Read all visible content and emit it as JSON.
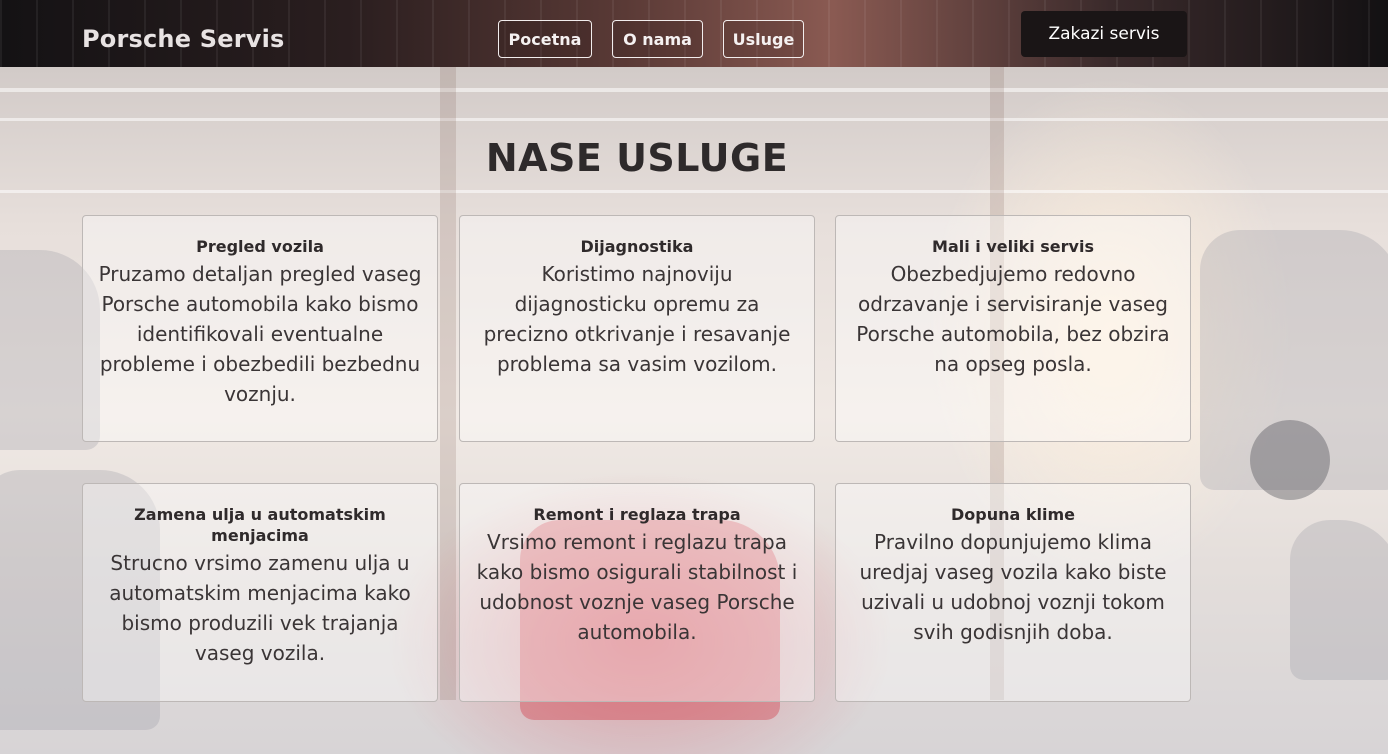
{
  "nav": {
    "logo": "Porsche Servis",
    "links": [
      "Pocetna",
      "O nama",
      "Usluge"
    ],
    "cta_label": "Zakazi servis"
  },
  "main": {
    "title": "NASE USLUGE",
    "services": [
      {
        "title": "Pregled vozila",
        "text": "Pruzamo detaljan pregled vaseg Porsche automobila kako bismo identifikovali eventualne probleme i obezbedili bezbednu voznju."
      },
      {
        "title": "Dijagnostika",
        "text": "Koristimo najnoviju dijagnosticku opremu za precizno otkrivanje i resavanje problema sa vasim vozilom."
      },
      {
        "title": "Mali i veliki servis",
        "text": "Obezbedjujemo redovno odrzavanje i servisiranje vaseg Porsche automobila, bez obzira na opseg posla."
      },
      {
        "title": "Zamena ulja u automatskim menjacima",
        "text": "Strucno vrsimo zamenu ulja u automatskim menjacima kako bismo produzili vek trajanja vaseg vozila."
      },
      {
        "title": "Remont i reglaza trapa",
        "text": "Vrsimo remont i reglazu trapa kako bismo osigurali stabilnost i udobnost voznje vaseg Porsche automobila."
      },
      {
        "title": "Dopuna klime",
        "text": "Pravilno dopunjujemo klima uredjaj vaseg vozila kako biste uzivali u udobnoj voznji tokom svih godisnjih doba."
      }
    ]
  }
}
